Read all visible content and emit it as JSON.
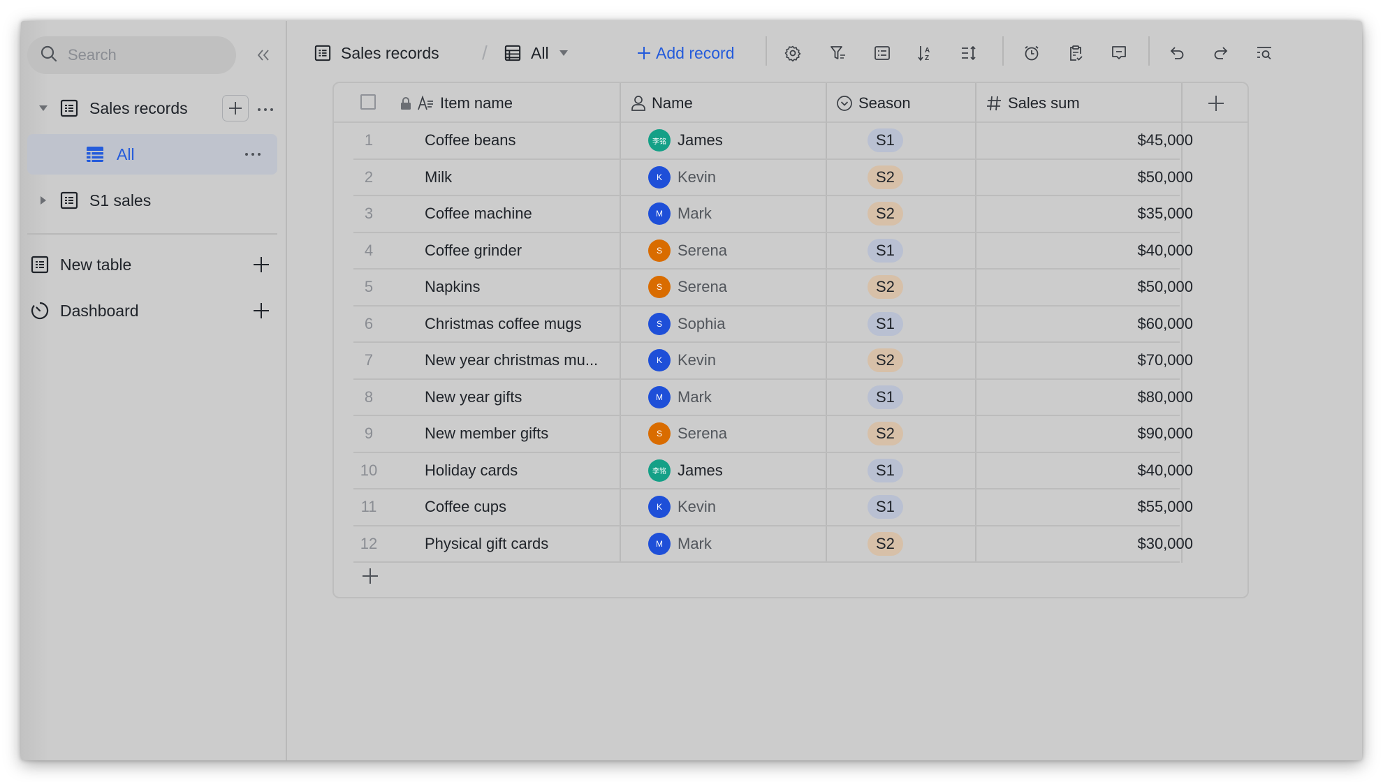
{
  "sidebar": {
    "search_placeholder": "Search",
    "tables": [
      {
        "label": "Sales records",
        "expanded": true,
        "views": [
          {
            "label": "All",
            "active": true
          }
        ]
      },
      {
        "label": "S1 sales",
        "expanded": false
      }
    ],
    "actions": [
      {
        "label": "New table",
        "icon": "table-icon"
      },
      {
        "label": "Dashboard",
        "icon": "dashboard-icon"
      }
    ]
  },
  "toolbar": {
    "table_name": "Sales records",
    "view_name": "All",
    "add_record_label": "Add record",
    "icons": [
      "settings-icon",
      "filter-icon",
      "group-icon",
      "sort-icon",
      "row-height-icon",
      "reminder-icon",
      "clipboard-icon",
      "comment-icon",
      "undo-icon",
      "redo-icon",
      "search-records-icon"
    ]
  },
  "table": {
    "columns": [
      {
        "label": "Item name",
        "type": "text"
      },
      {
        "label": "Name",
        "type": "person"
      },
      {
        "label": "Season",
        "type": "single-select"
      },
      {
        "label": "Sales sum",
        "type": "number"
      }
    ],
    "tag_colors": {
      "S1": "#b9c0d2",
      "S2": "#d7c0a8"
    },
    "rows": [
      {
        "index": "1",
        "item": "Coffee beans",
        "person": "James",
        "avatar": "李铭",
        "avatar_color": "#14a087",
        "season": "S1",
        "sales": "$45,000"
      },
      {
        "index": "2",
        "item": "Milk",
        "person": "Kevin",
        "avatar": "K",
        "avatar_color": "#1e4fd8",
        "season": "S2",
        "sales": "$50,000"
      },
      {
        "index": "3",
        "item": "Coffee machine",
        "person": "Mark",
        "avatar": "M",
        "avatar_color": "#1e4fd8",
        "season": "S2",
        "sales": "$35,000"
      },
      {
        "index": "4",
        "item": "Coffee grinder",
        "person": "Serena",
        "avatar": "S",
        "avatar_color": "#d96c00",
        "season": "S1",
        "sales": "$40,000"
      },
      {
        "index": "5",
        "item": "Napkins",
        "person": "Serena",
        "avatar": "S",
        "avatar_color": "#d96c00",
        "season": "S2",
        "sales": "$50,000"
      },
      {
        "index": "6",
        "item": "Christmas coffee mugs",
        "person": "Sophia",
        "avatar": "S",
        "avatar_color": "#1e4fd8",
        "season": "S1",
        "sales": "$60,000"
      },
      {
        "index": "7",
        "item": "New year christmas mu...",
        "person": "Kevin",
        "avatar": "K",
        "avatar_color": "#1e4fd8",
        "season": "S2",
        "sales": "$70,000"
      },
      {
        "index": "8",
        "item": "New year gifts",
        "person": "Mark",
        "avatar": "M",
        "avatar_color": "#1e4fd8",
        "season": "S1",
        "sales": "$80,000"
      },
      {
        "index": "9",
        "item": "New member gifts",
        "person": "Serena",
        "avatar": "S",
        "avatar_color": "#d96c00",
        "season": "S2",
        "sales": "$90,000"
      },
      {
        "index": "10",
        "item": "Holiday cards",
        "person": "James",
        "avatar": "李铭",
        "avatar_color": "#14a087",
        "season": "S1",
        "sales": "$40,000"
      },
      {
        "index": "11",
        "item": "Coffee cups",
        "person": "Kevin",
        "avatar": "K",
        "avatar_color": "#1e4fd8",
        "season": "S1",
        "sales": "$55,000"
      },
      {
        "index": "12",
        "item": "Physical gift cards",
        "person": "Mark",
        "avatar": "M",
        "avatar_color": "#1e4fd8",
        "season": "S2",
        "sales": "$30,000"
      }
    ]
  },
  "colors": {
    "accent": "#245bdb",
    "active_item_bg": "#bfc3cd",
    "window_bg": "#cccccc"
  }
}
